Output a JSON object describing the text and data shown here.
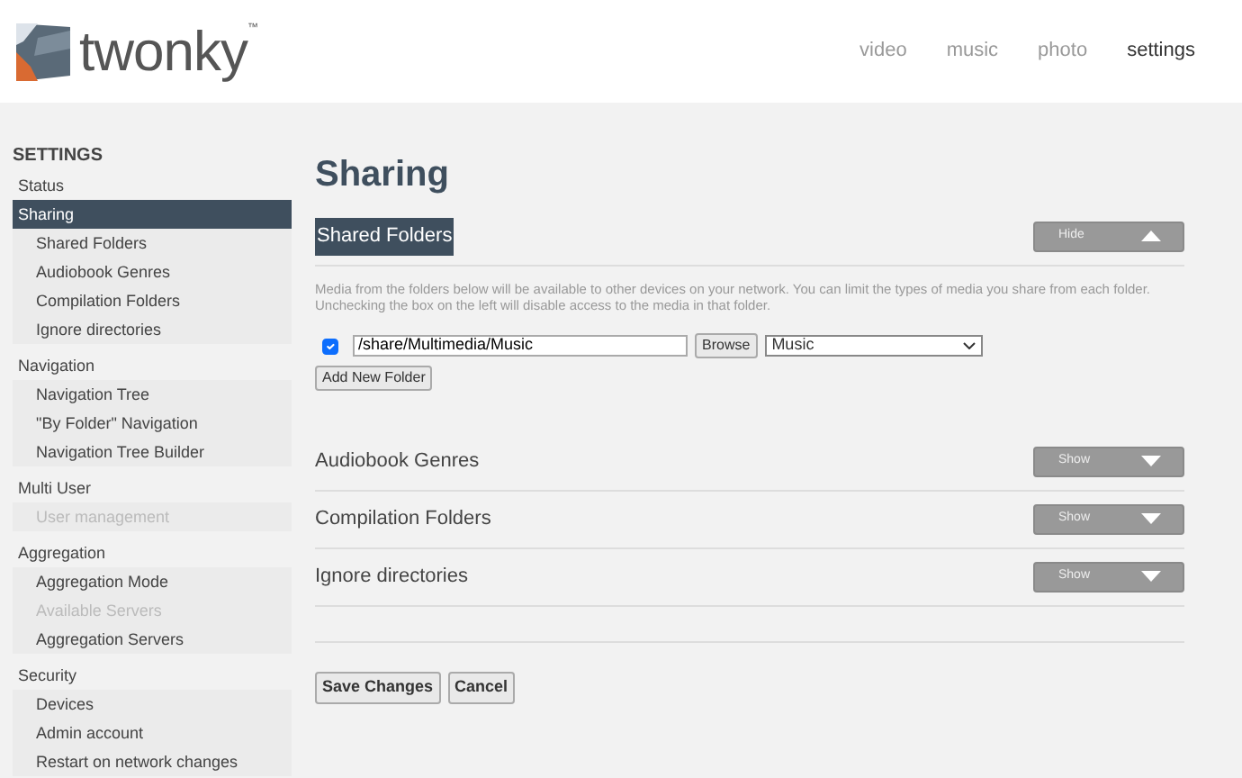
{
  "brand": {
    "name": "twonky",
    "mark": "™"
  },
  "nav": [
    {
      "label": "video",
      "selected": false
    },
    {
      "label": "music",
      "selected": false
    },
    {
      "label": "photo",
      "selected": false
    },
    {
      "label": "settings",
      "selected": true
    }
  ],
  "sidebar": {
    "title": "SETTINGS",
    "groups": [
      {
        "label": "Status",
        "selected": false
      },
      {
        "label": "Sharing",
        "selected": true,
        "children": [
          {
            "label": "Shared Folders",
            "disabled": false
          },
          {
            "label": "Audiobook Genres",
            "disabled": false
          },
          {
            "label": "Compilation Folders",
            "disabled": false
          },
          {
            "label": "Ignore directories",
            "disabled": false
          }
        ]
      },
      {
        "label": "Navigation",
        "selected": false,
        "children": [
          {
            "label": "Navigation Tree",
            "disabled": false
          },
          {
            "label": "\"By Folder\" Navigation",
            "disabled": false
          },
          {
            "label": "Navigation Tree Builder",
            "disabled": false
          }
        ]
      },
      {
        "label": "Multi User",
        "selected": false,
        "children": [
          {
            "label": "User management",
            "disabled": true
          }
        ]
      },
      {
        "label": "Aggregation",
        "selected": false,
        "children": [
          {
            "label": "Aggregation Mode",
            "disabled": false
          },
          {
            "label": "Available Servers",
            "disabled": true
          },
          {
            "label": "Aggregation Servers",
            "disabled": false
          }
        ]
      },
      {
        "label": "Security",
        "selected": false,
        "children": [
          {
            "label": "Devices",
            "disabled": false
          },
          {
            "label": "Admin account",
            "disabled": false
          },
          {
            "label": "Restart on network changes",
            "disabled": false
          }
        ]
      }
    ]
  },
  "page_title": "Sharing",
  "sections": [
    {
      "title": "Shared Folders",
      "expanded": true,
      "toggle": "Hide",
      "description": "Media from the folders below will be available to other devices on your network. You can limit the types of media you share from each folder. Unchecking the box on the left will disable access to the media in that folder.",
      "folders": [
        {
          "checked": true,
          "path": "/share/Multimedia/Music",
          "browse": "Browse",
          "media_type": "Music"
        }
      ],
      "add_button": "Add New Folder"
    },
    {
      "title": "Audiobook Genres",
      "expanded": false,
      "toggle": "Show"
    },
    {
      "title": "Compilation Folders",
      "expanded": false,
      "toggle": "Show"
    },
    {
      "title": "Ignore directories",
      "expanded": false,
      "toggle": "Show"
    }
  ],
  "buttons": [
    "Save Changes",
    "Cancel"
  ]
}
